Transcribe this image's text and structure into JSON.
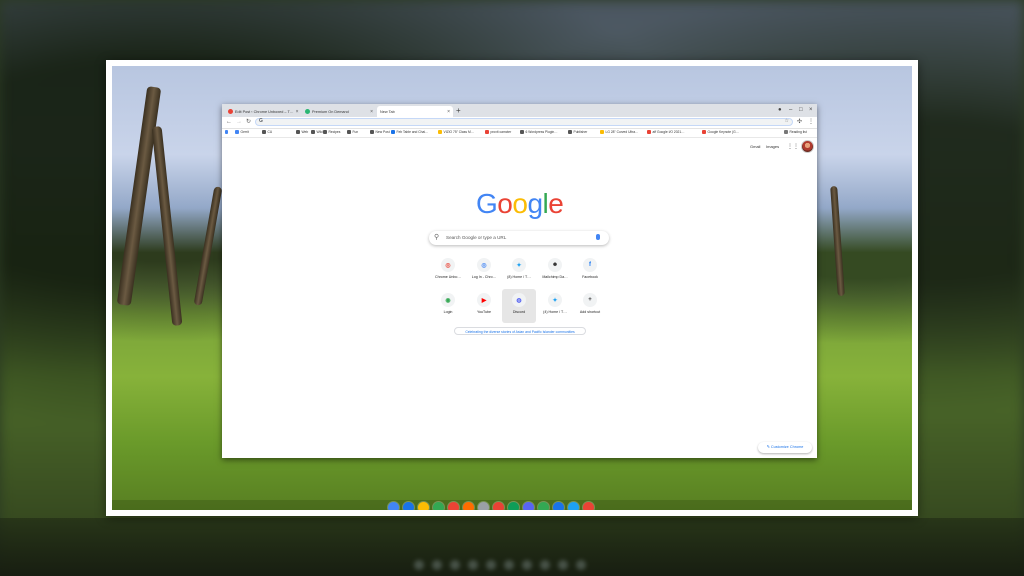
{
  "browser": {
    "tabs": [
      {
        "label": "Edit Post ‹ Chrome Unboxed – T…",
        "active": false,
        "favicon_color": "#e94235"
      },
      {
        "label": "Premium On Demand",
        "active": false,
        "favicon_color": "#2bb673"
      },
      {
        "label": "New Tab",
        "active": true,
        "favicon_color": ""
      }
    ],
    "new_tab_symbol": "+",
    "window_controls": {
      "profile": "●",
      "minimize": "–",
      "maximize": "□",
      "close": "×"
    },
    "omnibox": {
      "icon": "G",
      "value": ""
    },
    "reading_list": "Reading list",
    "bookmarks": [
      {
        "label": "Gerrit",
        "color": "#4285f4"
      },
      {
        "label": "CU",
        "color": "#555"
      },
      {
        "label": "Web",
        "color": "#555"
      },
      {
        "label": "Wiki",
        "color": "#555"
      },
      {
        "label": "Recipes",
        "color": "#555"
      },
      {
        "label": "Fun",
        "color": "#555"
      },
      {
        "label": "New Post",
        "color": "#555"
      },
      {
        "label": "Feb Table and Chai…",
        "color": "#1a73e8"
      },
      {
        "label": "VIZIO 75\" Class M…",
        "color": "#fbbc04"
      },
      {
        "label": "proxit camcter",
        "color": "#e94235"
      },
      {
        "label": "6 Wordpress Plugin…",
        "color": "#555"
      },
      {
        "label": "Publisher",
        "color": "#555"
      },
      {
        "label": "LG 28\" Curved Ultra…",
        "color": "#fbbc04"
      },
      {
        "label": "aff Google I/O 2021…",
        "color": "#e94235"
      },
      {
        "label": "Google Keynote (G…",
        "color": "#e94235"
      }
    ]
  },
  "ntp": {
    "gmail": "Gmail",
    "images": "Images",
    "logo_letters": [
      "G",
      "o",
      "o",
      "g",
      "l",
      "e"
    ],
    "logo_colors": [
      "#4285f4",
      "#ea4335",
      "#fbbc05",
      "#4285f4",
      "#34a853",
      "#ea4335"
    ],
    "search_placeholder": "Search Google or type a URL",
    "shortcuts_row1": [
      {
        "label": "Chrome Unbo…",
        "icon": "chrome-unboxed-icon",
        "glyph": "◎",
        "color": "#e94235"
      },
      {
        "label": "Log In - Chro…",
        "icon": "chrome-icon",
        "glyph": "◎",
        "color": "#4285f4"
      },
      {
        "label": "(8) Home / T…",
        "icon": "twitter-icon",
        "glyph": "✦",
        "color": "#1da1f2"
      },
      {
        "label": "Mailchimp Da…",
        "icon": "mailchimp-icon",
        "glyph": "☻",
        "color": "#222"
      },
      {
        "label": "Facebook",
        "icon": "facebook-icon",
        "glyph": "f",
        "color": "#1877f2"
      }
    ],
    "shortcuts_row2": [
      {
        "label": "Login",
        "icon": "login-icon",
        "glyph": "◉",
        "color": "#34a853"
      },
      {
        "label": "YouTube",
        "icon": "youtube-icon",
        "glyph": "▶",
        "color": "#ff0000"
      },
      {
        "label": "Discord",
        "icon": "discord-icon",
        "glyph": "◍",
        "color": "#5865f2"
      },
      {
        "label": "(4) Home / T…",
        "icon": "twitter-icon",
        "glyph": "✦",
        "color": "#1da1f2"
      },
      {
        "label": "Add shortcut",
        "icon": "plus-icon",
        "glyph": "+",
        "color": "#333"
      }
    ],
    "doodle_link": "Celebrating the diverse stories of Asian and Pacific Islander communities",
    "customize": "✎ Customize Chrome"
  },
  "shelf": {
    "app_colors": [
      "#4285f4",
      "#1a73e8",
      "#fbbc04",
      "#34a853",
      "#ea4335",
      "#ff6d00",
      "#9aa0a6",
      "#e94235",
      "#0f9d58",
      "#5865f2",
      "#34a853",
      "#1a73e8",
      "#1da1f2",
      "#ea4335"
    ]
  }
}
